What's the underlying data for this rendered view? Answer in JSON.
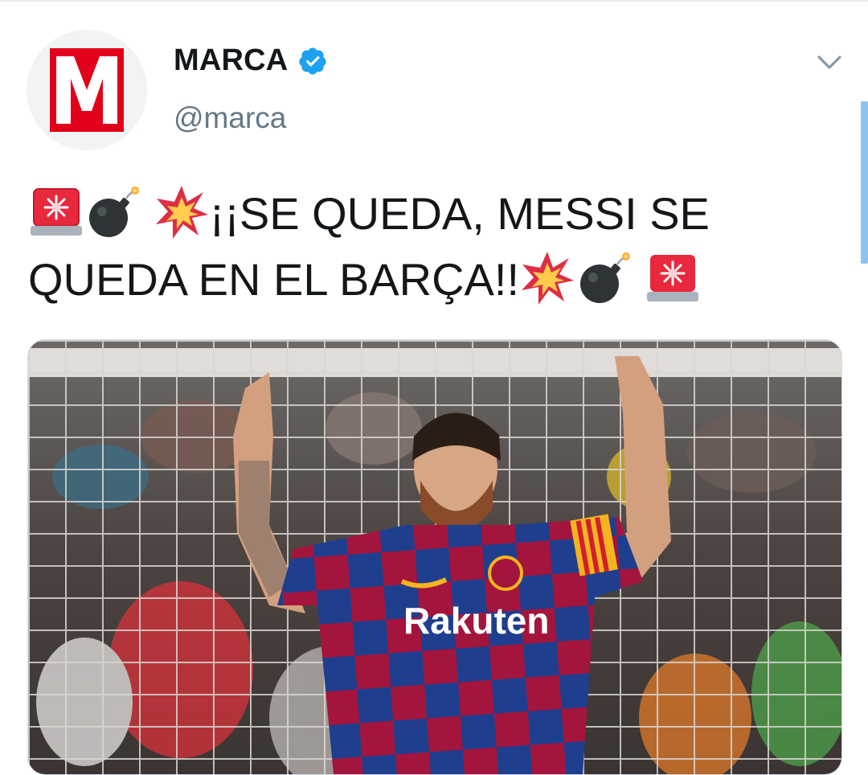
{
  "account": {
    "name": "MARCA",
    "handle": "@marca",
    "logo_letter": "M",
    "verified": true,
    "verified_icon": "verified-badge-icon",
    "menu_icon": "chevron-down-icon"
  },
  "tweet": {
    "line1_text": "¡¡SE QUEDA, MESSI SE",
    "line2_text": "QUEDA EN EL BARÇA!!",
    "line1_emojis": [
      "siren-icon",
      "bomb-icon",
      "collision-icon"
    ],
    "line2_emojis": [
      "collision-icon",
      "bomb-icon",
      "siren-icon"
    ]
  },
  "media": {
    "alt": "photo",
    "jersey_sponsor": "Rakuten"
  },
  "colors": {
    "brand_red": "#e2001a",
    "verified_blue": "#1da1f2",
    "text": "#14171a",
    "muted": "#657786"
  }
}
